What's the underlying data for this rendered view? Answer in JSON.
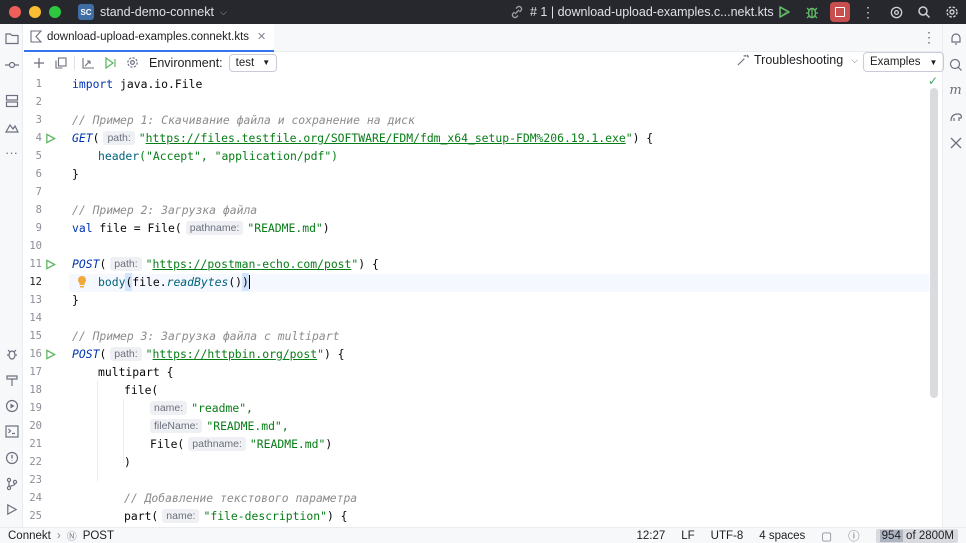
{
  "titlebar": {
    "project_badge": "SC",
    "project_name": "stand-demo-connekt",
    "run_config": "# 1 | download-upload-examples.c...nekt.kts"
  },
  "tab": {
    "label": "download-upload-examples.connekt.kts"
  },
  "toolbar": {
    "environment_label": "Environment:",
    "environment_value": "test",
    "troubleshooting_label": "Troubleshooting",
    "examples_label": "Examples"
  },
  "editor": {
    "line_numbers": [
      "1",
      "2",
      "3",
      "4",
      "5",
      "6",
      "7",
      "8",
      "9",
      "10",
      "11",
      "12",
      "13",
      "14",
      "15",
      "16",
      "17",
      "18",
      "19",
      "20",
      "21",
      "22",
      "23",
      "24",
      "25"
    ],
    "current_line": "12",
    "tokens": {
      "l1_import": "import",
      "l1_rest": " java.io.File",
      "l3": "// Пример 1: Скачивание файла и сохранение на диск",
      "l4_get": "GET",
      "l4_paren": "(",
      "l4_hint": "path:",
      "l4_q1": "\"",
      "l4_url": "https://files.testfile.org/SOFTWARE/FDM/fdm_x64_setup-FDM%206.19.1.exe",
      "l4_q2": "\"",
      "l4_end": ") {",
      "l5_fn": "header",
      "l5_args": "(\"Accept\", \"application/pdf\")",
      "l6": "}",
      "l8": "// Пример 2: Загрузка файла",
      "l9_val": "val",
      "l9_mid": " file = File(",
      "l9_hint": "pathname:",
      "l9_str": "\"README.md\"",
      "l9_end": ")",
      "l11_post": "POST",
      "l11_paren": "(",
      "l11_hint": "path:",
      "l11_url": "https://postman-echo.com/post",
      "l11_end": ") {",
      "l12_fn": "body",
      "l12_p": "(",
      "l12_file": "file.",
      "l12_call": "readBytes",
      "l12_pp": "()",
      "l12_end": ")",
      "l13": "}",
      "l15": "// Пример 3: Загрузка файла с multipart",
      "l16_post": "POST",
      "l16_paren": "(",
      "l16_hint": "path:",
      "l16_url": "https://httpbin.org/post",
      "l16_end": ") {",
      "l17": "multipart {",
      "l18": "file(",
      "l19_hint": "name:",
      "l19_str": "\"readme\",",
      "l20_hint": "fileName:",
      "l20_str": "\"README.md\",",
      "l21_fn": "File(",
      "l21_hint": "pathname:",
      "l21_str": "\"README.md\"",
      "l21_end": ")",
      "l22": ")",
      "l24": "// Добавление текстового параметра",
      "l25_fn": "part(",
      "l25_hint": "name:",
      "l25_str": "\"file-description\"",
      "l25_end": ") {"
    }
  },
  "statusbar": {
    "crumb1": "Connekt",
    "crumb2": "POST",
    "position": "12:27",
    "line_sep": "LF",
    "encoding": "UTF-8",
    "indent": "4 spaces",
    "mem_used": "954",
    "mem_total": "of 2800M"
  },
  "colors": {
    "titlebar_bg": "#27282e",
    "accent": "#3574f0",
    "run_green": "#5fb865",
    "stop_red": "#c94f4f",
    "keyword": "#0033b3",
    "string": "#067d17",
    "comment": "#8c8c8c"
  },
  "icons": [
    "folder-icon",
    "commit-icon",
    "structure-icon",
    "services-icon",
    "more-icon",
    "run-icon",
    "debug-icon",
    "stop-icon",
    "more-vert-icon",
    "copilot-icon",
    "search-icon",
    "settings-icon",
    "close-icon",
    "add-icon",
    "copy-icon",
    "collapse-icon",
    "run-all-icon",
    "gear-icon",
    "bulb-icon",
    "check-icon"
  ]
}
